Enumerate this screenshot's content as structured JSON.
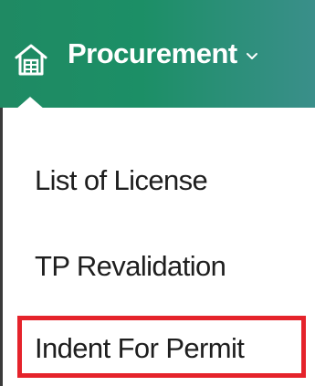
{
  "nav": {
    "icon": "warehouse-icon",
    "label": "Procurement",
    "chevron": "chevron-down-icon",
    "colors": {
      "bar_start": "#1f8a63",
      "bar_end": "#3a8f8a",
      "text": "#ffffff"
    }
  },
  "dropdown": {
    "items": [
      {
        "label": "List of License"
      },
      {
        "label": "TP Revalidation"
      },
      {
        "label": "Indent For Permit",
        "highlighted": true
      }
    ],
    "highlight_color": "#e5232b"
  }
}
